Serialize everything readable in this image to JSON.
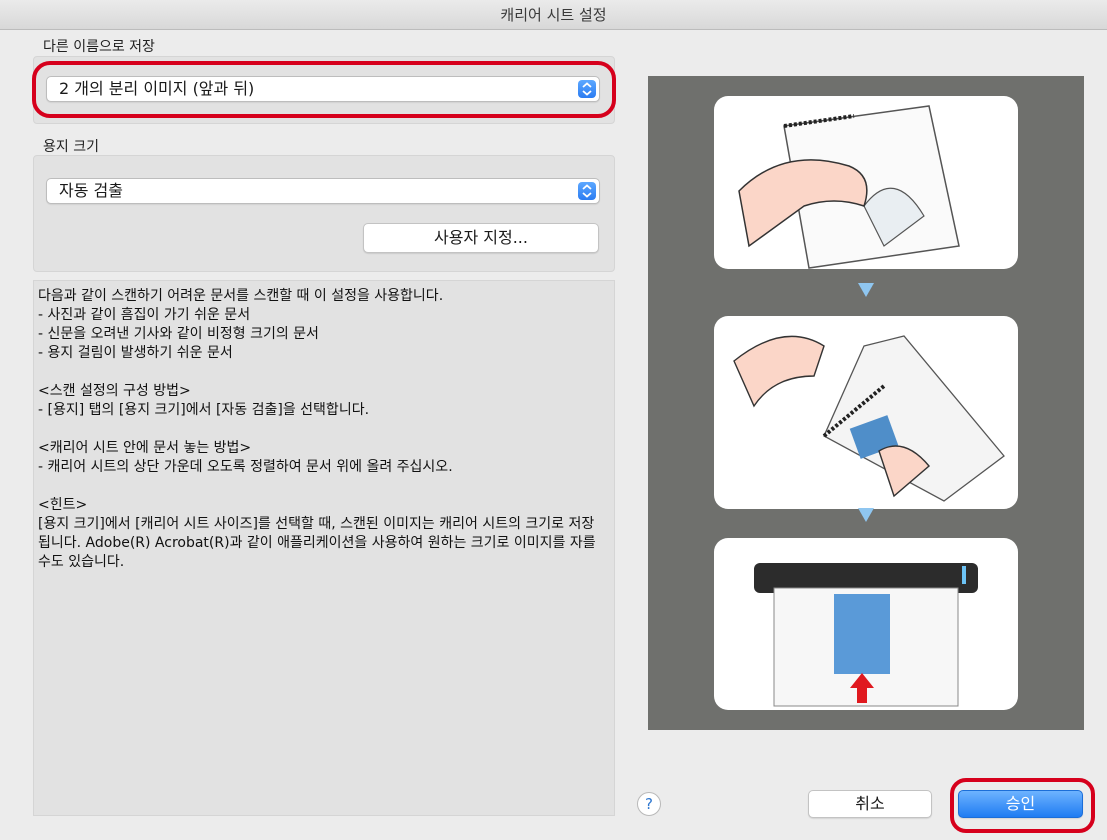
{
  "window": {
    "title": "캐리어 시트 설정"
  },
  "save_as": {
    "label": "다른 이름으로 저장",
    "selected": "2 개의 분리 이미지 (앞과 뒤)",
    "highlight_color": "#d6001c"
  },
  "paper_size": {
    "label": "용지 크기",
    "selected": "자동 검출",
    "custom_button": "사용자 지정..."
  },
  "description": "다음과 같이 스캔하기 어려운 문서를 스캔할 때 이 설정을 사용합니다.\n- 사진과 같이 흠집이 가기 쉬운 문서\n- 신문을 오려낸 기사와 같이 비정형 크기의 문서\n- 용지 걸림이 발생하기 쉬운 문서\n\n<스캔 설정의 구성 방법>\n- [용지] 탭의 [용지 크기]에서 [자동 검출]을 선택합니다.\n\n<캐리어 시트 안에 문서 놓는 방법>\n- 캐리어 시트의 상단 가운데 오도록 정렬하여 문서 위에 올려 주십시오.\n\n<힌트>\n[용지 크기]에서 [캐리어 시트 사이즈]를 선택할 때, 스캔된 이미지는 캐리어 시트의 크기로 저장\n됩니다. Adobe(R) Acrobat(R)과 같이 애플리케이션을 사용하여 원하는 크기로 이미지를 자를\n수도 있습니다.",
  "footer": {
    "help": "?",
    "cancel": "취소",
    "ok": "승인",
    "accent": "#1f7cf2"
  }
}
